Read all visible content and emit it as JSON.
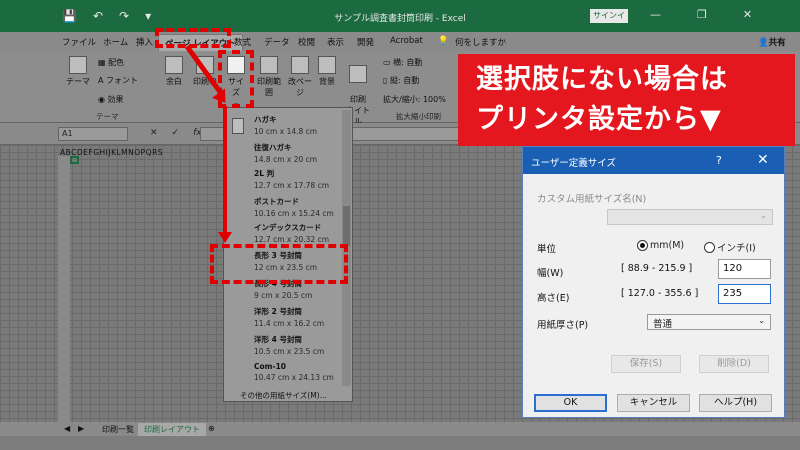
{
  "window": {
    "title": "サンプル調査書封筒印刷 - Excel",
    "signin_label": "サインイン",
    "qat": [
      "💾",
      "↶",
      "↷",
      "▾"
    ],
    "controls": [
      "—",
      "❐",
      "✕"
    ]
  },
  "ribbon_tabs": [
    "ファイル",
    "ホーム",
    "挿入",
    "ページ レイアウト",
    "数式",
    "データ",
    "校閲",
    "表示",
    "開発",
    "Acrobat",
    "何をしますか"
  ],
  "share_label": "共有",
  "ribbon": {
    "theme_label": "テーマ",
    "color_label": "配色",
    "font_label": "フォント",
    "effect_label": "効果",
    "margin_label": "余白",
    "orientation_label": "印刷の",
    "size_label": "サイズ",
    "print_area_label": "印刷範囲",
    "break_label": "改ページ",
    "background_label": "背景",
    "print_titles_label": "印刷\nタイトル",
    "width_label": "横:",
    "width_value": "自動",
    "height_label": "縦:",
    "height_value": "自動",
    "scale_label": "拡大/縮小:",
    "scale_value": "100%",
    "group_theme": "テーマ",
    "group_scale": "拡大縮小印刷"
  },
  "formula_bar": {
    "name_box": "A1",
    "fx": "fx",
    "cancel": "✕",
    "enter": "✓"
  },
  "sheet": {
    "column_headers": "ABCDEFGHIJKLMNOPQRS",
    "sheet_tabs": [
      "印刷一覧",
      "印刷レイアウト"
    ],
    "active_sheet": "印刷レイアウト"
  },
  "paper_sizes": [
    {
      "name": "ハガキ",
      "size": "10 cm x 14.8 cm"
    },
    {
      "name": "往復ハガキ",
      "size": "14.8 cm x 20 cm"
    },
    {
      "name": "2L 判",
      "size": "12.7 cm x 17.78 cm"
    },
    {
      "name": "ポストカード",
      "size": "10.16 cm x 15.24 cm"
    },
    {
      "name": "インデックスカード",
      "size": "12.7 cm x 20.32 cm"
    },
    {
      "name": "長形 3 号封筒",
      "size": "12 cm x 23.5 cm"
    },
    {
      "name": "長形 4 号封筒",
      "size": "9 cm x 20.5 cm"
    },
    {
      "name": "洋形 2 号封筒",
      "size": "11.4 cm x 16.2 cm"
    },
    {
      "name": "洋形 4 号封筒",
      "size": "10.5 cm x 23.5 cm"
    },
    {
      "name": "Com-10",
      "size": "10.47 cm x 24.13 cm"
    }
  ],
  "paper_sizes_more": "その他の用紙サイズ(M)...",
  "callout": {
    "line1": "選択肢にない場合は",
    "line2": "プリンタ設定から▼"
  },
  "dialog": {
    "title": "ユーザー定義サイズ",
    "help_icon": "?",
    "close_icon": "✕",
    "custom_name_label": "カスタム用紙サイズ名(N)",
    "unit_label": "単位",
    "unit_mm": "mm(M)",
    "unit_inch": "インチ(I)",
    "width_label": "幅(W)",
    "width_range": "[ 88.9 - 215.9 ]",
    "width_value": "120",
    "height_label": "高さ(E)",
    "height_range": "[ 127.0 - 355.6 ]",
    "height_value": "235",
    "thickness_label": "用紙厚さ(P)",
    "thickness_value": "普通",
    "save_label": "保存(S)",
    "delete_label": "削除(D)",
    "ok_label": "OK",
    "cancel_label": "キャンセル",
    "help_label": "ヘルプ(H)"
  }
}
